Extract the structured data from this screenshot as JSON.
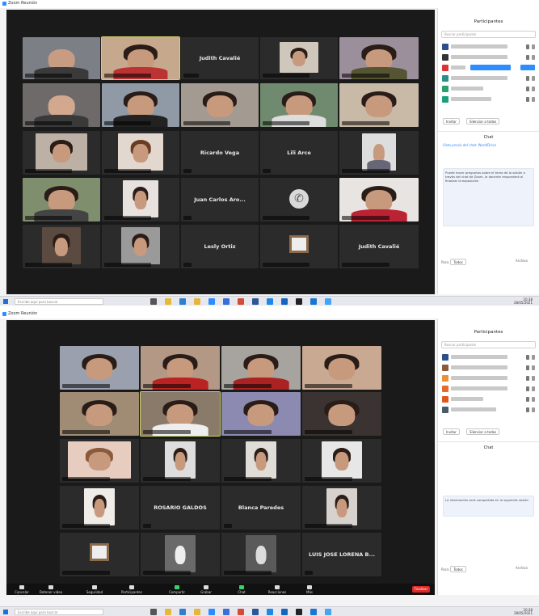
{
  "window": {
    "title": "Zoom Reunión"
  },
  "top": {
    "name_tiles": [
      "Judith Cavalié",
      "Ricardo Vega",
      "Lili Arce",
      "Juan Carlos Aro...",
      "Lesly Ortiz",
      "Judith Cavalié"
    ],
    "panel": {
      "title": "Participantes",
      "search_placeholder": "Buscar participante",
      "buttons": [
        "Invitar",
        "Silenciar a todos"
      ],
      "chat_title": "Chat",
      "chat_link": "Vista previa del chat: Word/Drive",
      "chat_text": "Puede hacer preguntas sobre el tema de la sesión a través del chat de Zoom, la docente responderá al finalizar la exposición",
      "to_label": "Para:",
      "to_value": "Todos",
      "file_label": "Archivo"
    }
  },
  "bottom": {
    "name_tiles": [
      "ROSARIO GALDOS",
      "Blanca Paredes",
      "LUIS JOSE LORENA B..."
    ],
    "panel": {
      "title": "Participantes",
      "search_placeholder": "Buscar participante",
      "buttons": [
        "Invitar",
        "Silenciar a todos"
      ],
      "chat_title": "Chat",
      "chat_text": "La información será compartida en la siguiente sesión",
      "to_label": "Para:",
      "to_value": "Todos",
      "file_label": "Archivo"
    },
    "toolbar": {
      "items": [
        "Cancelar silencio",
        "Detener video",
        "Seguridad",
        "Participantes",
        "Compartir",
        "Grabar",
        "Chat",
        "Reacciones",
        "Más"
      ],
      "end_label": "Finalizar"
    }
  },
  "taskbar": {
    "search_placeholder": "Escribe aquí para buscar",
    "time": "10:38",
    "date": "28/05/2021"
  },
  "colors": {
    "accent": "#2d8cff",
    "speaker_outline": "#c9d36a",
    "end_button": "#e02828"
  }
}
